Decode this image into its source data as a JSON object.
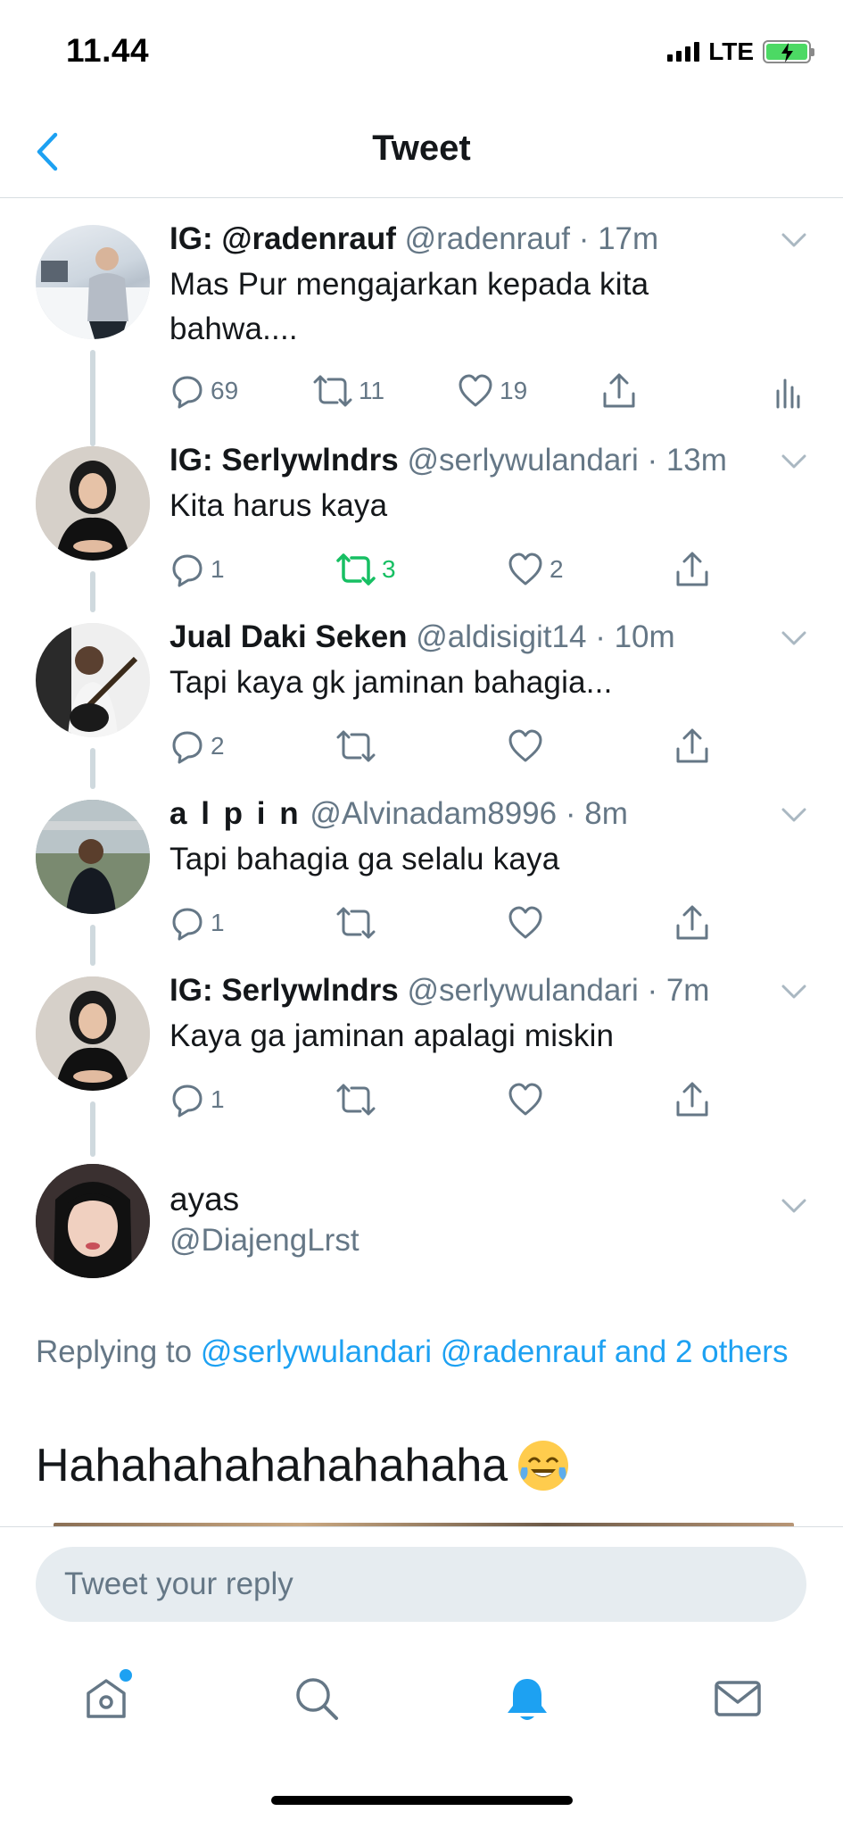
{
  "status_bar": {
    "time": "11.44",
    "network": "LTE"
  },
  "nav": {
    "title": "Tweet"
  },
  "tweets": [
    {
      "name": "IG: @radenrauf",
      "handle": "@radenrauf",
      "time": "17m",
      "text": "Mas Pur mengajarkan kepada kita bahwa....",
      "replies": "69",
      "retweets": "11",
      "likes": "19"
    },
    {
      "name": "IG: Serlywlndrs",
      "handle": "@serlywulandari",
      "time": "13m",
      "text": "Kita harus kaya",
      "replies": "1",
      "retweets": "3",
      "likes": "2"
    },
    {
      "name": "Jual Daki Seken",
      "handle": "@aldisigit14",
      "time": "10m",
      "text": "Tapi kaya gk jaminan bahagia...",
      "replies": "2",
      "retweets": "",
      "likes": ""
    },
    {
      "name": "a l p i n",
      "handle": "@Alvinadam8996",
      "time": "8m",
      "text": "Tapi bahagia ga selalu kaya",
      "replies": "1",
      "retweets": "",
      "likes": ""
    },
    {
      "name": "IG: Serlywlndrs",
      "handle": "@serlywulandari",
      "time": "7m",
      "text": "Kaya ga jaminan apalagi miskin",
      "replies": "1",
      "retweets": "",
      "likes": ""
    }
  ],
  "focused": {
    "name": "ayas",
    "handle": "@DiajengLrst",
    "replying_prefix": "Replying to ",
    "replying_links": "@serlywulandari @radenrauf and 2 others",
    "text": "Hahahahahahahahaha"
  },
  "reply_bar": {
    "placeholder": "Tweet your reply"
  },
  "colors": {
    "accent": "#1da1f2",
    "retweet_active": "#17bf63",
    "muted": "#657786",
    "text": "#14171a"
  },
  "icons": [
    "chevron-left-icon",
    "chevron-down-icon",
    "reply-icon",
    "retweet-icon",
    "like-icon",
    "share-icon",
    "analytics-icon",
    "home-icon",
    "search-icon",
    "notifications-icon",
    "messages-icon"
  ]
}
